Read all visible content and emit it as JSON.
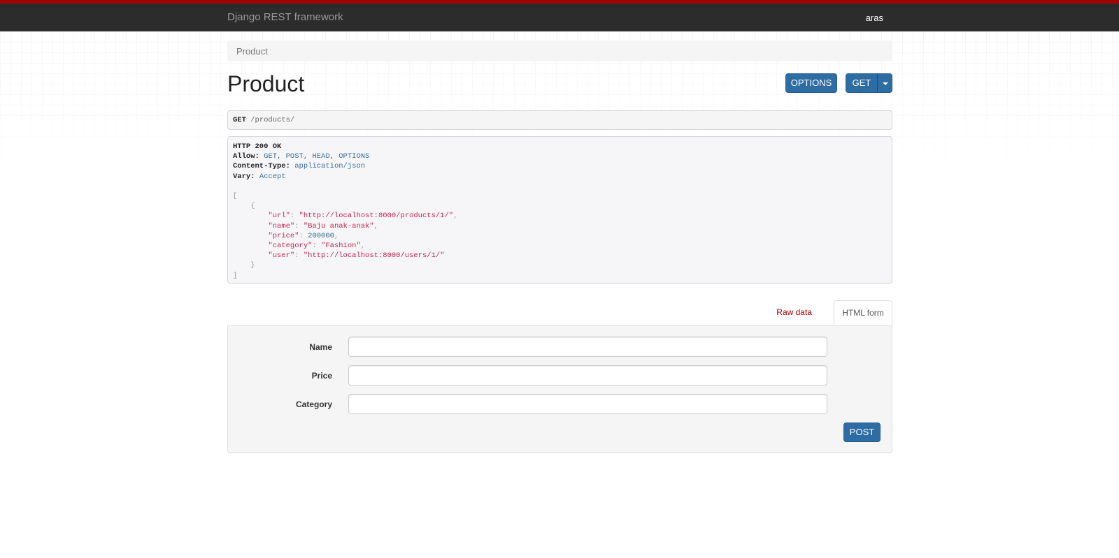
{
  "navbar": {
    "brand": "Django REST framework",
    "user": "aras"
  },
  "breadcrumb": {
    "items": [
      "Product"
    ]
  },
  "page": {
    "title": "Product",
    "options_button": "OPTIONS",
    "get_button": "GET"
  },
  "request": {
    "method": "GET",
    "path": "/products/"
  },
  "response": {
    "status": "HTTP 200 OK",
    "headers": [
      {
        "key": "Allow:",
        "value": "GET, POST, HEAD, OPTIONS"
      },
      {
        "key": "Content-Type:",
        "value": "application/json"
      },
      {
        "key": "Vary:",
        "value": "Accept"
      }
    ],
    "body": [
      {
        "url": "http://localhost:8000/products/1/",
        "name": "Baju anak-anak",
        "price": "200000",
        "category": "Fashion",
        "user": "http://localhost:8000/users/1/"
      }
    ]
  },
  "tabs": {
    "raw": "Raw data",
    "html": "HTML form"
  },
  "form": {
    "fields": [
      {
        "label": "Name",
        "value": ""
      },
      {
        "label": "Price",
        "value": ""
      },
      {
        "label": "Category",
        "value": ""
      }
    ],
    "submit": "POST"
  },
  "colors": {
    "navbar_bg": "#2c2c2c",
    "navbar_accent": "#a30000",
    "button": "#2e6da4",
    "raw_tab_link": "#a30000"
  }
}
